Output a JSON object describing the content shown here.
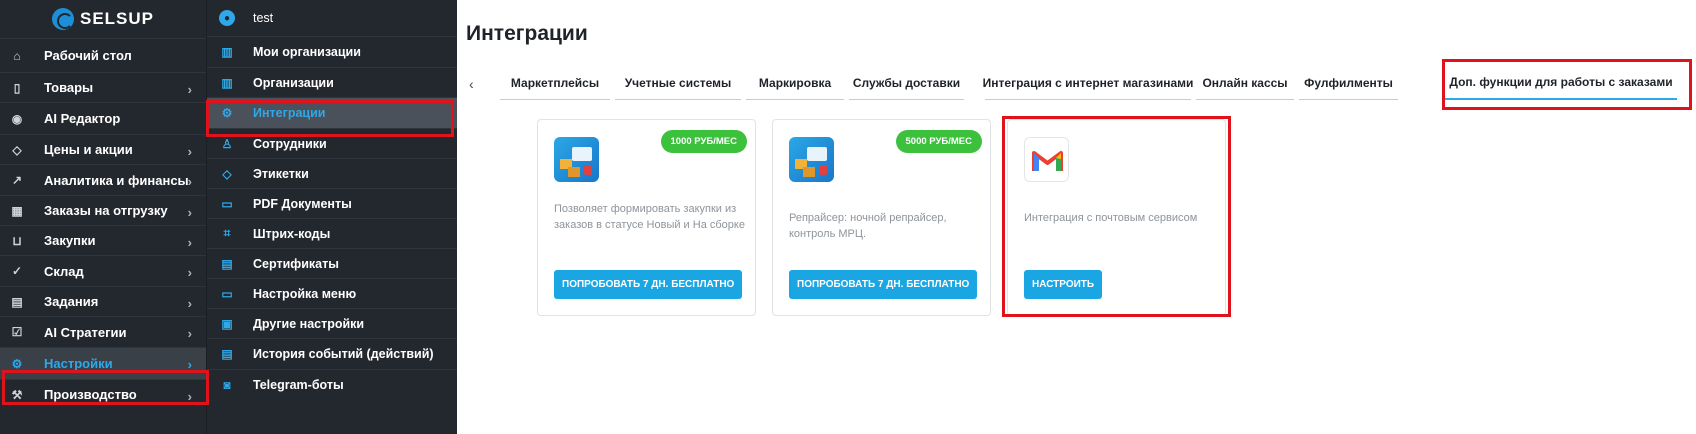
{
  "brand": {
    "logo_text": "SELSUP"
  },
  "sidebar": {
    "items": [
      {
        "label": "Рабочий стол",
        "icon": "home-icon",
        "chevron": false,
        "active": false
      },
      {
        "label": "Товары",
        "icon": "bag-icon",
        "chevron": true,
        "active": false
      },
      {
        "label": "AI Редактор",
        "icon": "camera-icon",
        "chevron": false,
        "active": false
      },
      {
        "label": "Цены и акции",
        "icon": "tag-icon",
        "chevron": true,
        "active": false
      },
      {
        "label": "Аналитика и финансы",
        "icon": "chart-icon",
        "chevron": true,
        "active": false
      },
      {
        "label": "Заказы на отгрузку",
        "icon": "calculator-icon",
        "chevron": true,
        "active": false
      },
      {
        "label": "Закупки",
        "icon": "cart-icon",
        "chevron": true,
        "active": false
      },
      {
        "label": "Склад",
        "icon": "check-circle-icon",
        "chevron": true,
        "active": false
      },
      {
        "label": "Задания",
        "icon": "calendar-icon",
        "chevron": true,
        "active": false
      },
      {
        "label": "AI Стратегии",
        "icon": "checkbox-icon",
        "chevron": true,
        "active": false
      },
      {
        "label": "Настройки",
        "icon": "gear-icon",
        "chevron": true,
        "active": true
      },
      {
        "label": "Производство",
        "icon": "wrench-icon",
        "chevron": true,
        "active": false
      }
    ]
  },
  "submenu": {
    "user": "test",
    "items": [
      {
        "label": "Мои организации",
        "icon": "building-icon",
        "active": false
      },
      {
        "label": "Организации",
        "icon": "building-icon",
        "active": false
      },
      {
        "label": "Интеграции",
        "icon": "integration-icon",
        "active": true
      },
      {
        "label": "Сотрудники",
        "icon": "person-icon",
        "active": false
      },
      {
        "label": "Этикетки",
        "icon": "label-icon",
        "active": false
      },
      {
        "label": "PDF Документы",
        "icon": "pdf-icon",
        "active": false
      },
      {
        "label": "Штрих-коды",
        "icon": "barcode-icon",
        "active": false
      },
      {
        "label": "Сертификаты",
        "icon": "certificate-icon",
        "active": false
      },
      {
        "label": "Настройка меню",
        "icon": "menu-icon",
        "active": false
      },
      {
        "label": "Другие настройки",
        "icon": "settings-icon",
        "active": false
      },
      {
        "label": "История событий (действий)",
        "icon": "history-icon",
        "active": false
      },
      {
        "label": "Telegram-боты",
        "icon": "bot-icon",
        "active": false
      }
    ]
  },
  "main": {
    "title": "Интеграции",
    "tabs": [
      {
        "label": "Маркетплейсы",
        "active": false
      },
      {
        "label": "Учетные системы",
        "active": false
      },
      {
        "label": "Маркировка",
        "active": false
      },
      {
        "label": "Службы доставки",
        "active": false
      },
      {
        "label": "Интеграция с интернет магазинами",
        "active": false
      },
      {
        "label": "Онлайн кассы",
        "active": false
      },
      {
        "label": "Фулфилменты",
        "active": false
      },
      {
        "label": "Доп. функции для работы с заказами",
        "active": true
      }
    ],
    "cards": [
      {
        "icon": "robot-boxes-icon",
        "price": "1000 РУБ/МЕС",
        "description": "Позволяет формировать закупки из заказов в статусе Новый и На сборке",
        "button": "ПОПРОБОВАТЬ 7 ДН. БЕСПЛАТНО"
      },
      {
        "icon": "robot-boxes-icon",
        "price": "5000 РУБ/МЕС",
        "description": "Репрайсер: ночной репрайсер, контроль МРЦ.",
        "button": "ПОПРОБОВАТЬ 7 ДН. БЕСПЛАТНО"
      },
      {
        "icon": "gmail-icon",
        "price": "",
        "description": "Интеграция с почтовым сервисом",
        "button": "НАСТРОИТЬ"
      }
    ]
  },
  "colors": {
    "sidebar_bg": "#23272e",
    "accent": "#2ea8e8",
    "button": "#19a6e3",
    "badge": "#3cc13c",
    "highlight": "#e0121c"
  }
}
